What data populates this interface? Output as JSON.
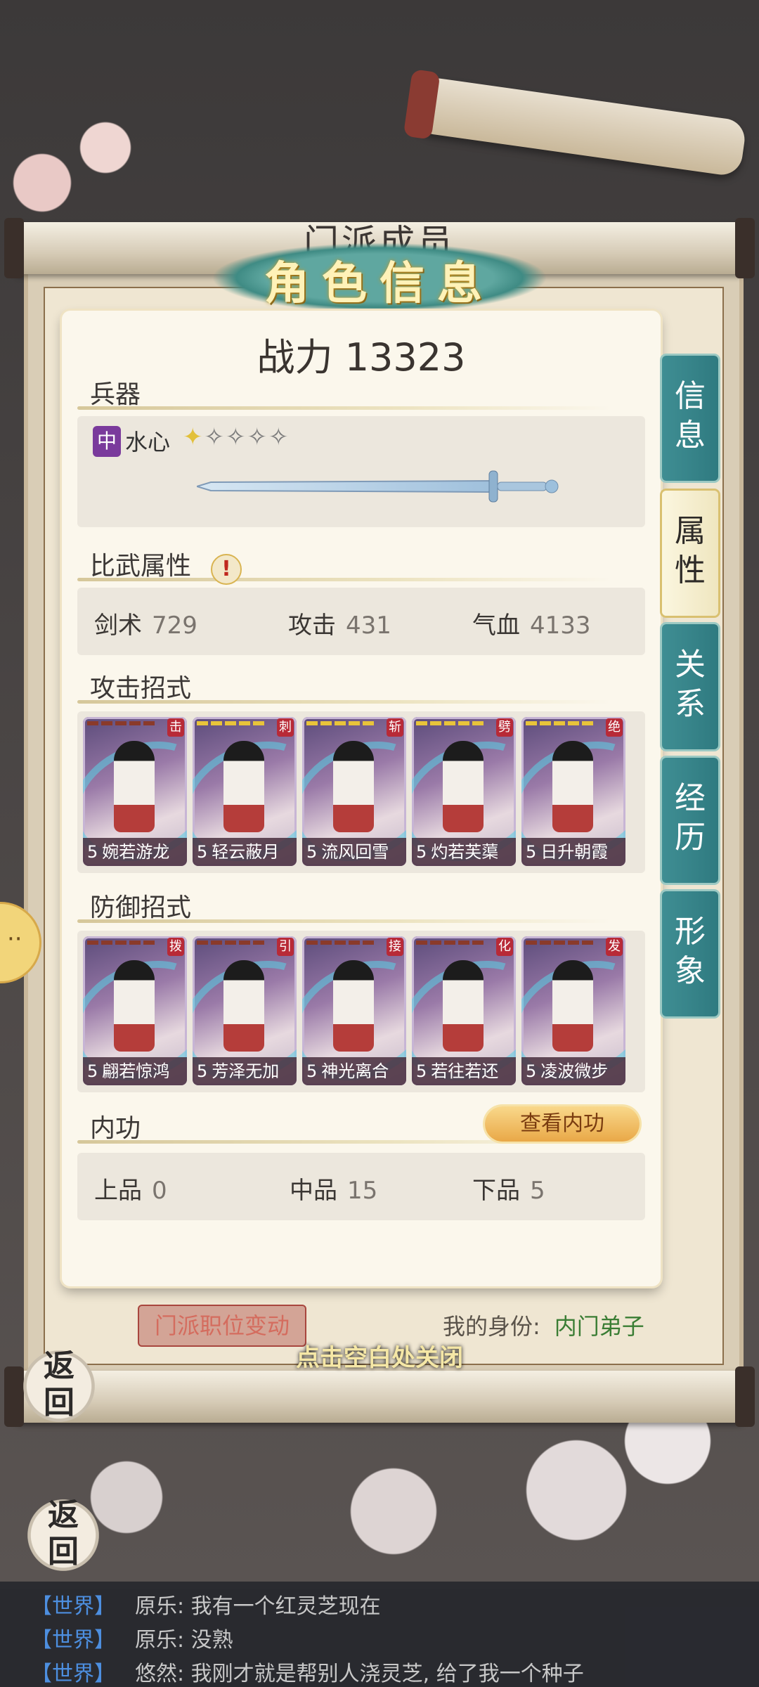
{
  "header": {
    "scroll_title": "门派成员",
    "banner_title": "角色信息"
  },
  "power": {
    "label": "战力",
    "value": "13323"
  },
  "weapon": {
    "section": "兵器",
    "grade_tag": "中",
    "name": "水心",
    "stars_total": 5,
    "stars_filled": 1
  },
  "combat_attrs": {
    "section": "比武属性",
    "items": [
      {
        "label": "剑术",
        "value": "729"
      },
      {
        "label": "攻击",
        "value": "431"
      },
      {
        "label": "气血",
        "value": "4133"
      }
    ]
  },
  "attack_moves": {
    "section": "攻击招式",
    "cards": [
      {
        "level": "5",
        "name": "婉若游龙",
        "tag": "击"
      },
      {
        "level": "5",
        "name": "轻云蔽月",
        "tag": "刺"
      },
      {
        "level": "5",
        "name": "流风回雪",
        "tag": "斩"
      },
      {
        "level": "5",
        "name": "灼若芙蕖",
        "tag": "劈"
      },
      {
        "level": "5",
        "name": "日升朝霞",
        "tag": "绝"
      }
    ]
  },
  "defense_moves": {
    "section": "防御招式",
    "cards": [
      {
        "level": "5",
        "name": "翩若惊鸿",
        "tag": "拨"
      },
      {
        "level": "5",
        "name": "芳泽无加",
        "tag": "引"
      },
      {
        "level": "5",
        "name": "神光离合",
        "tag": "接"
      },
      {
        "level": "5",
        "name": "若往若还",
        "tag": "化"
      },
      {
        "level": "5",
        "name": "凌波微步",
        "tag": "发"
      }
    ]
  },
  "neigong": {
    "section": "内功",
    "button": "查看内功",
    "items": [
      {
        "label": "上品",
        "value": "0"
      },
      {
        "label": "中品",
        "value": "15"
      },
      {
        "label": "下品",
        "value": "5"
      }
    ]
  },
  "tabs": [
    {
      "line1": "信",
      "line2": "息",
      "active": false
    },
    {
      "line1": "属",
      "line2": "性",
      "active": true
    },
    {
      "line1": "关",
      "line2": "系",
      "active": false
    },
    {
      "line1": "经",
      "line2": "历",
      "active": false
    },
    {
      "line1": "形",
      "line2": "象",
      "active": false
    }
  ],
  "footer": {
    "rank_change_button": "门派职位变动",
    "identity_label": "我的身份:",
    "identity_value": "内门弟子",
    "close_hint": "点击空白处关闭",
    "back_line1": "返",
    "back_line2": "回"
  },
  "chat": [
    {
      "channel": "【世界】",
      "text": "原乐: 我有一个红灵芝现在"
    },
    {
      "channel": "【世界】",
      "text": "原乐: 没熟"
    },
    {
      "channel": "【世界】",
      "text": "悠然: 我刚才就是帮别人浇灵芝, 给了我一个种子"
    }
  ],
  "colors": {
    "tab_teal": "#2f7a80",
    "tab_active": "#efe6bf",
    "weapon_tag_purple": "#7a3a9c",
    "card_tag_red": "#b82a37",
    "identity_green": "#3a7d34",
    "chat_channel_blue": "#4d8fe0"
  }
}
